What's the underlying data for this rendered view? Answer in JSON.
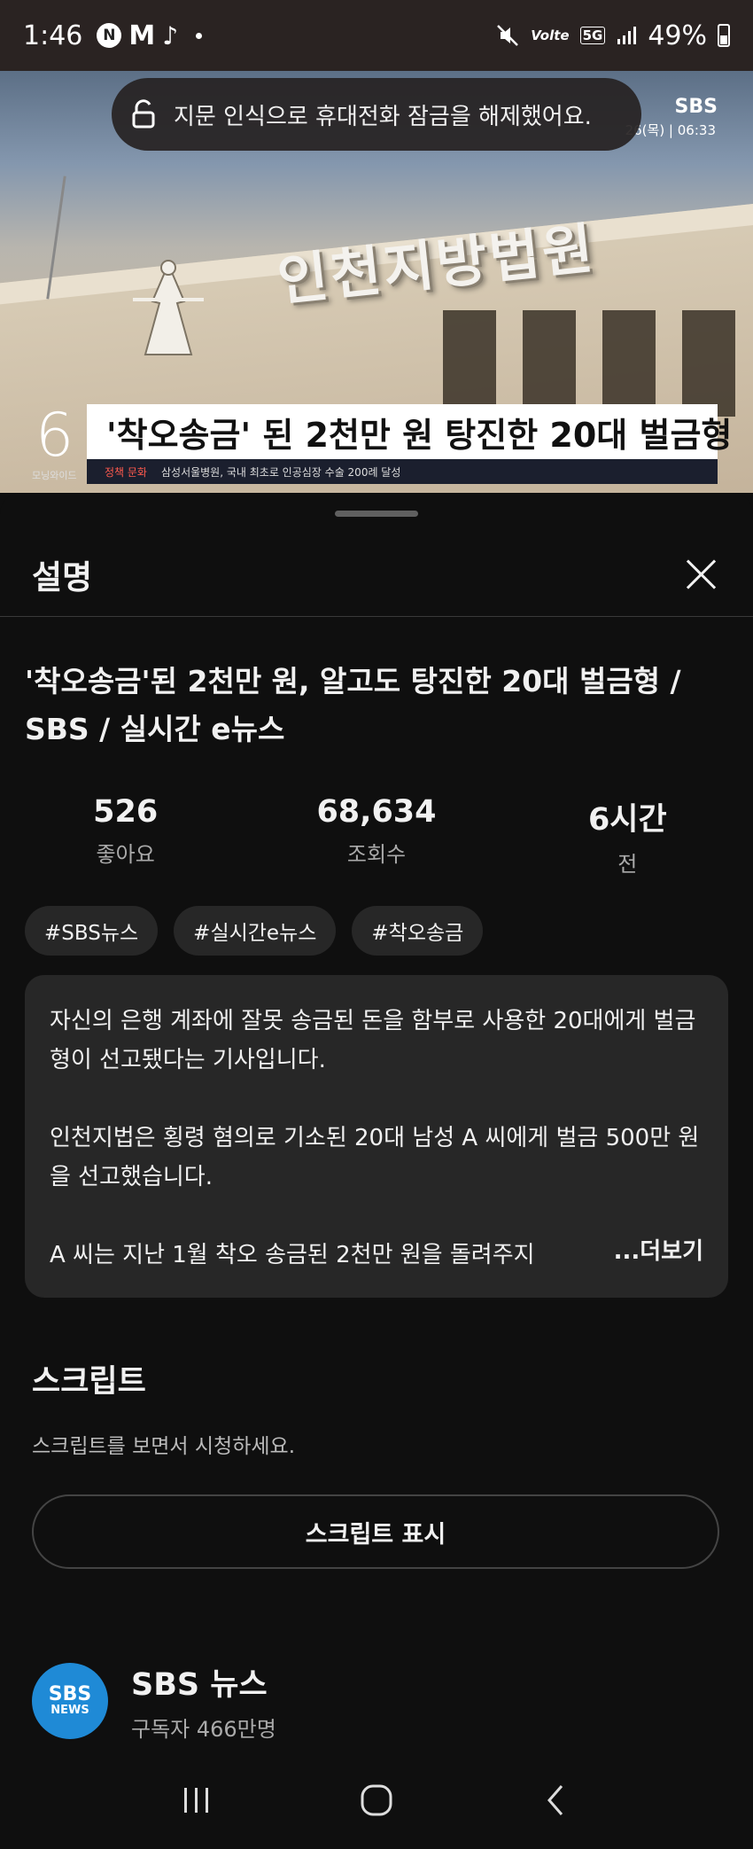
{
  "status_bar": {
    "time": "1:46",
    "app_icons": [
      "N",
      "M",
      "♪"
    ],
    "network_volte": "Volte",
    "network_5g": "5G",
    "battery": "49%"
  },
  "video": {
    "toast": "지문 인식으로 휴대전화 잠금을 해제했어요.",
    "building_sign": "인천지방법원",
    "channel_logo": "SBS",
    "broadcast_time": "26(목) | 06:33",
    "program_number": "6",
    "program_name": "모닝와이드",
    "caption": "'착오송금' 된 2천만 원 탕진한 20대 벌금형",
    "ticker_tag": "정책 문화",
    "ticker_text": "삼성서울병원, 국내 최초로 인공심장 수술 200례 달성"
  },
  "sheet": {
    "title": "설명",
    "video_title": "'착오송금'된 2천만 원, 알고도 탕진한 20대 벌금형 / SBS / 실시간 e뉴스",
    "stats": [
      {
        "value": "526",
        "label": "좋아요"
      },
      {
        "value": "68,634",
        "label": "조회수"
      },
      {
        "value": "6시간",
        "label": "전"
      }
    ],
    "tags": [
      "#SBS뉴스",
      "#실시간e뉴스",
      "#착오송금"
    ],
    "description": {
      "para1": "자신의 은행 계좌에 잘못 송금된 돈을 함부로 사용한 20대에게 벌금형이 선고됐다는 기사입니다.",
      "para2": "인천지법은 횡령 혐의로 기소된 20대 남성 A 씨에게 벌금 500만 원을 선고했습니다.",
      "para3": "A 씨는 지난 1월 착오 송금된 2천만 원을 돌려주지",
      "more": "...더보기"
    },
    "script": {
      "title": "스크립트",
      "subtitle": "스크립트를 보면서 시청하세요.",
      "button": "스크립트 표시"
    },
    "channel": {
      "avatar_line1": "SBS",
      "avatar_line2": "NEWS",
      "name": "SBS 뉴스",
      "subscribers": "구독자 466만명"
    }
  },
  "colors": {
    "background": "#0f0f0f",
    "card": "#272727",
    "channel_avatar": "#1f8ad6"
  }
}
